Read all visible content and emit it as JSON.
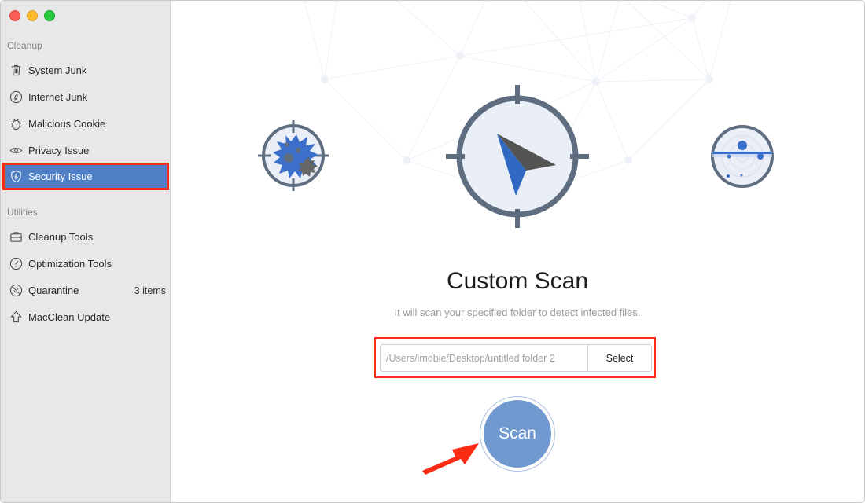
{
  "window": {
    "controls": [
      "close",
      "minimize",
      "maximize"
    ]
  },
  "sidebar": {
    "sections": [
      {
        "label": "Cleanup",
        "items": [
          {
            "label": "System Junk",
            "icon": "trash-icon"
          },
          {
            "label": "Internet Junk",
            "icon": "compass-leaf-icon"
          },
          {
            "label": "Malicious Cookie",
            "icon": "bug-icon"
          },
          {
            "label": "Privacy Issue",
            "icon": "eye-icon"
          },
          {
            "label": "Security Issue",
            "icon": "shield-icon",
            "active": true
          }
        ]
      },
      {
        "label": "Utilities",
        "items": [
          {
            "label": "Cleanup Tools",
            "icon": "toolbox-icon"
          },
          {
            "label": "Optimization Tools",
            "icon": "gauge-icon"
          },
          {
            "label": "Quarantine",
            "icon": "quarantine-icon",
            "badge": "3 items"
          },
          {
            "label": "MacClean Update",
            "icon": "upload-arrow-icon"
          }
        ]
      }
    ]
  },
  "main": {
    "title": "Custom Scan",
    "subtitle": "It will scan your specified folder to detect infected files.",
    "path_field": {
      "value": "",
      "placeholder": "/Users/imobie/Desktop/untitled folder 2"
    },
    "select_label": "Select",
    "scan_label": "Scan",
    "icons": {
      "left": "virus-target-icon",
      "center": "compass-target-icon",
      "right": "radar-icon"
    }
  },
  "colors": {
    "accent": "#4f7fc4",
    "scan_button": "#7099d0",
    "highlight": "#fb2c14",
    "icon_stroke": "#5e6e80",
    "icon_fill": "#e9eef7"
  }
}
